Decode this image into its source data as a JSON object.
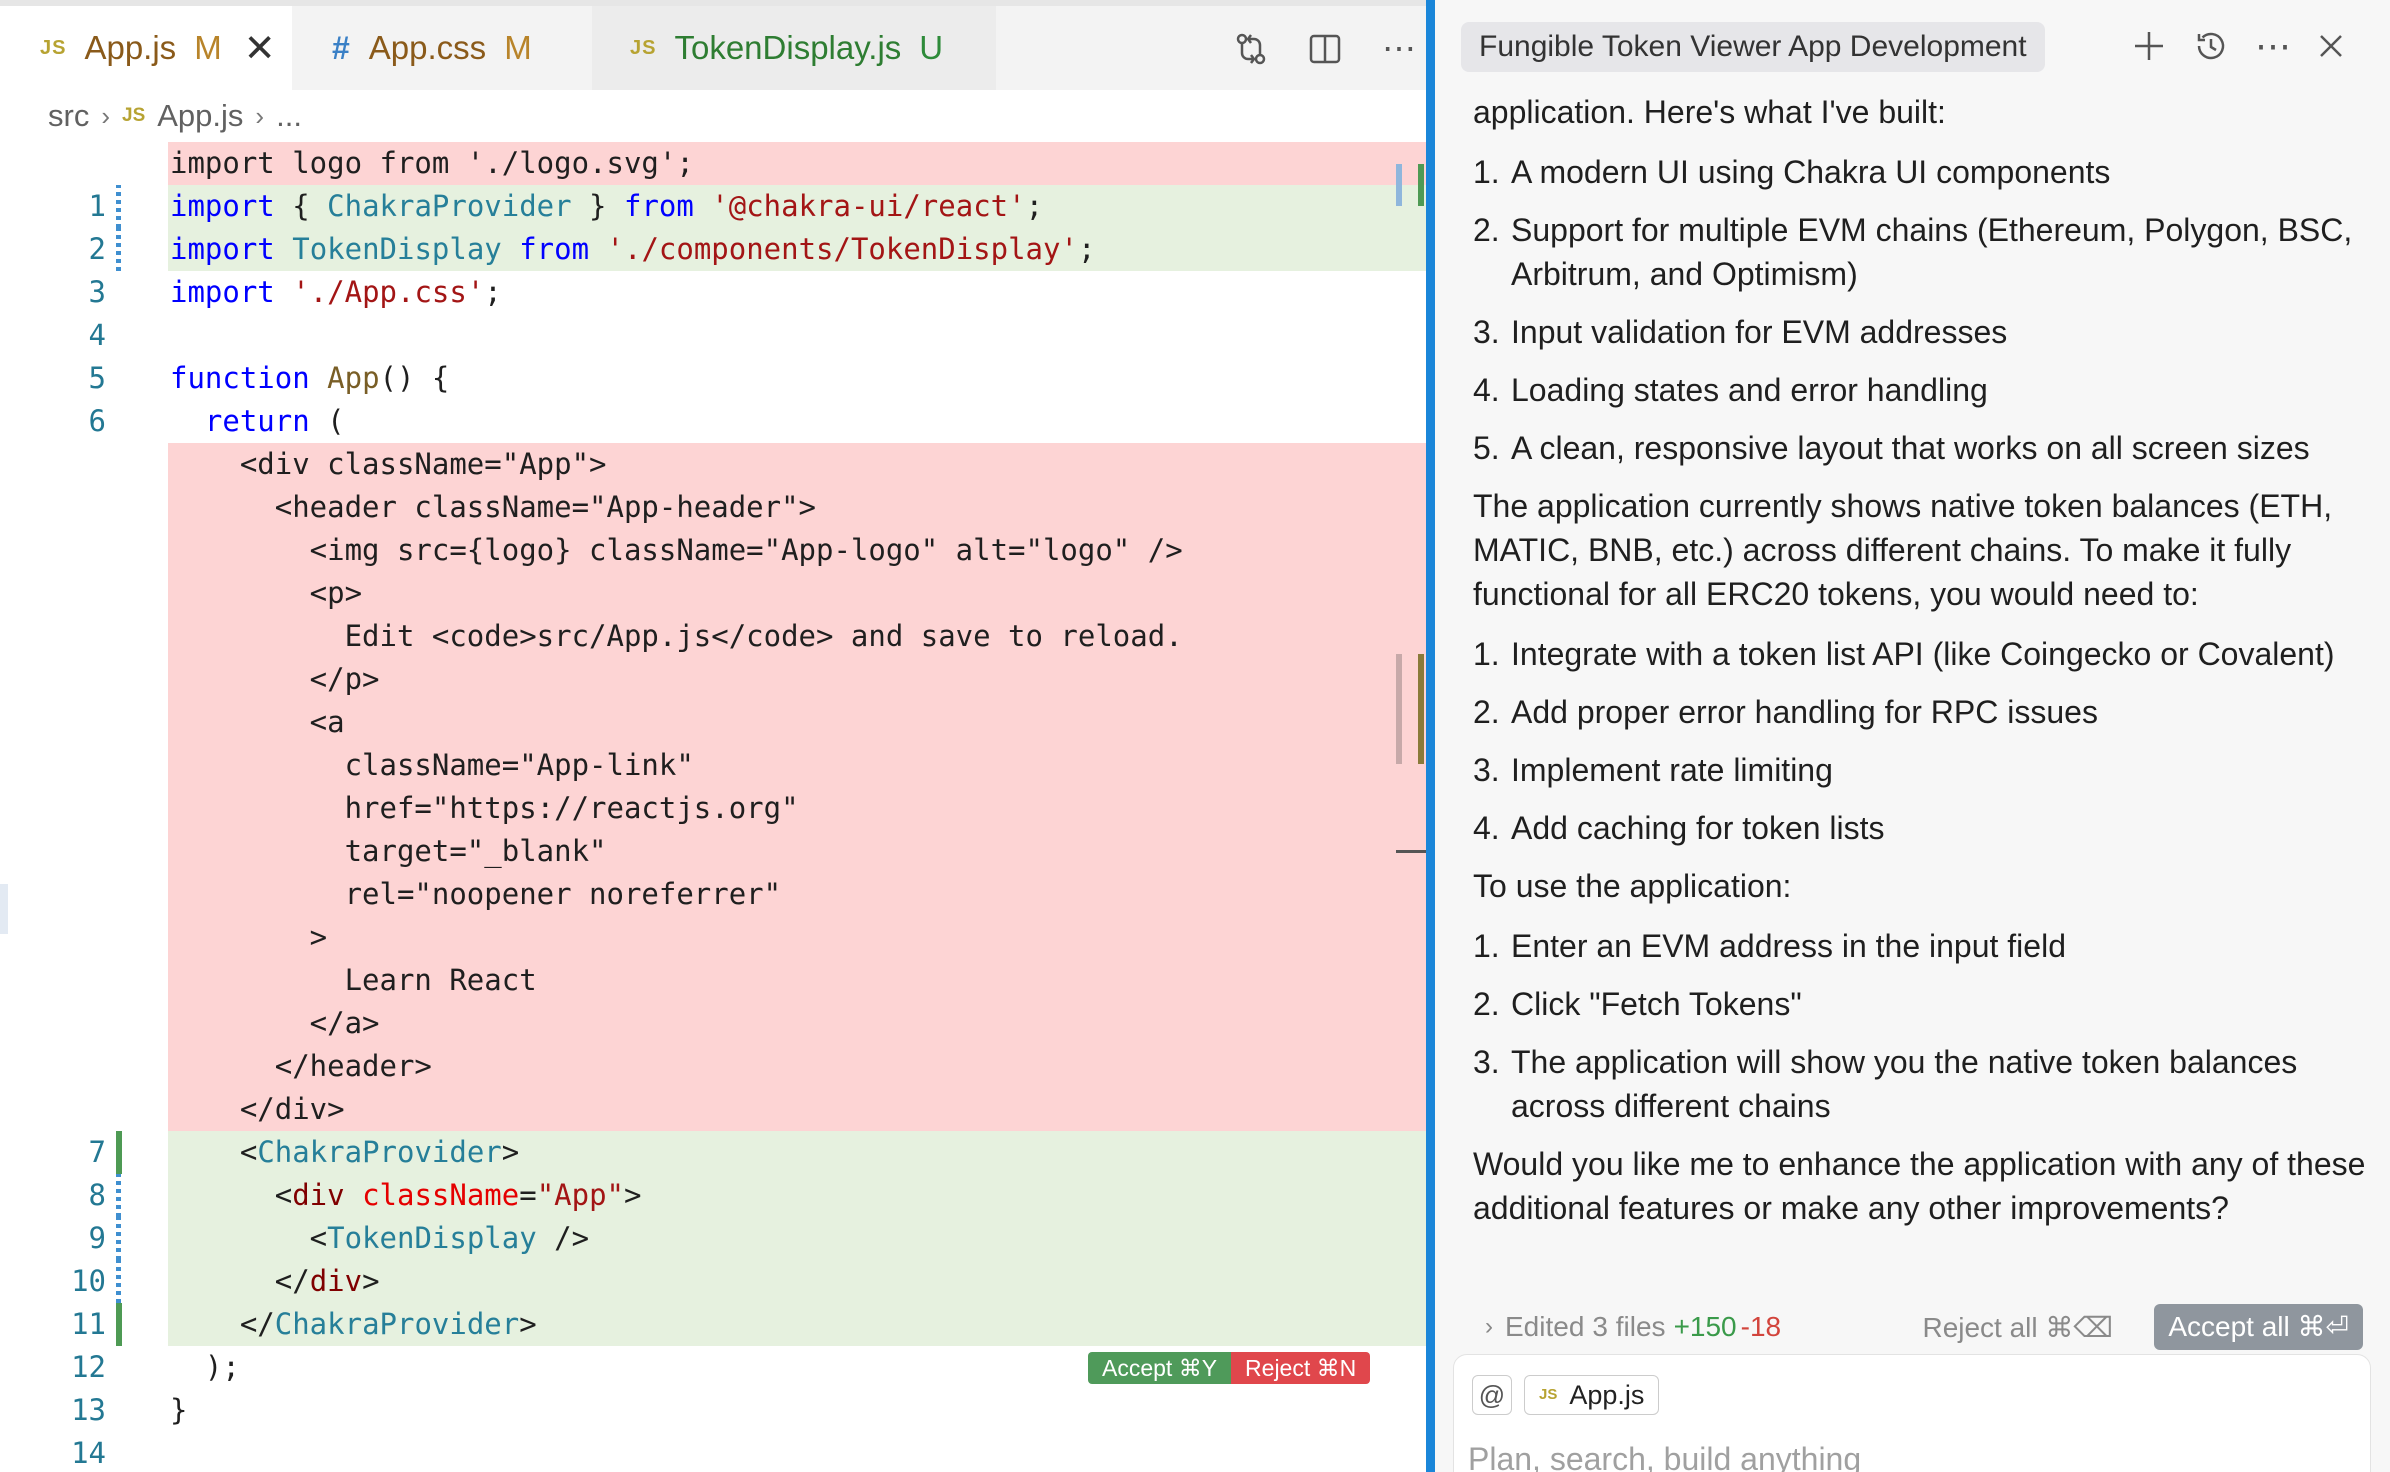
{
  "tabs": [
    {
      "icon": "JS",
      "name": "App.js",
      "status": "M",
      "active": true
    },
    {
      "icon": "#",
      "name": "App.css",
      "status": "M",
      "active": false
    },
    {
      "icon": "JS",
      "name": "TokenDisplay.js",
      "status": "U",
      "active": false
    }
  ],
  "breadcrumb": {
    "folder": "src",
    "file_icon": "JS",
    "file": "App.js",
    "more": "..."
  },
  "code_lines": [
    {
      "n": "",
      "type": "del",
      "text": "import logo from './logo.svg';"
    },
    {
      "n": "1",
      "type": "add",
      "text": "import { ChakraProvider } from '@chakra-ui/react';"
    },
    {
      "n": "2",
      "type": "add",
      "text": "import TokenDisplay from './components/TokenDisplay';"
    },
    {
      "n": "3",
      "type": "ctx",
      "text": "import './App.css';"
    },
    {
      "n": "4",
      "type": "ctx",
      "text": ""
    },
    {
      "n": "5",
      "type": "ctx",
      "text": "function App() {"
    },
    {
      "n": "6",
      "type": "ctx",
      "text": "  return ("
    },
    {
      "n": "",
      "type": "del",
      "text": "    <div className=\"App\">"
    },
    {
      "n": "",
      "type": "del",
      "text": "      <header className=\"App-header\">"
    },
    {
      "n": "",
      "type": "del",
      "text": "        <img src={logo} className=\"App-logo\" alt=\"logo\" />"
    },
    {
      "n": "",
      "type": "del",
      "text": "        <p>"
    },
    {
      "n": "",
      "type": "del",
      "text": "          Edit <code>src/App.js</code> and save to reload."
    },
    {
      "n": "",
      "type": "del",
      "text": "        </p>"
    },
    {
      "n": "",
      "type": "del",
      "text": "        <a"
    },
    {
      "n": "",
      "type": "del",
      "text": "          className=\"App-link\""
    },
    {
      "n": "",
      "type": "del",
      "text": "          href=\"https://reactjs.org\""
    },
    {
      "n": "",
      "type": "del",
      "text": "          target=\"_blank\""
    },
    {
      "n": "",
      "type": "del",
      "text": "          rel=\"noopener noreferrer\""
    },
    {
      "n": "",
      "type": "del",
      "text": "        >"
    },
    {
      "n": "",
      "type": "del",
      "text": "          Learn React"
    },
    {
      "n": "",
      "type": "del",
      "text": "        </a>"
    },
    {
      "n": "",
      "type": "del",
      "text": "      </header>"
    },
    {
      "n": "",
      "type": "del",
      "text": "    </div>"
    },
    {
      "n": "7",
      "type": "add",
      "text": "    <ChakraProvider>"
    },
    {
      "n": "8",
      "type": "add",
      "text": "      <div className=\"App\">"
    },
    {
      "n": "9",
      "type": "add",
      "text": "        <TokenDisplay />"
    },
    {
      "n": "10",
      "type": "add",
      "text": "      </div>"
    },
    {
      "n": "11",
      "type": "add",
      "text": "    </ChakraProvider>"
    },
    {
      "n": "12",
      "type": "ctx",
      "text": "  );"
    },
    {
      "n": "13",
      "type": "ctx",
      "text": "}"
    },
    {
      "n": "14",
      "type": "ctx",
      "text": ""
    }
  ],
  "diff_actions": {
    "accept": "Accept ⌘Y",
    "reject": "Reject ⌘N"
  },
  "chat": {
    "title": "Fungible Token Viewer App Development",
    "intro": "application. Here's what I've built:",
    "built_list": [
      "A modern UI using Chakra UI components",
      "Support for multiple EVM chains (Ethereum, Polygon, BSC, Arbitrum, and Optimism)",
      "Input validation for EVM addresses",
      "Loading states and error handling",
      "A clean, responsive layout that works on all screen sizes"
    ],
    "status_para": "The application currently shows native token balances (ETH, MATIC, BNB, etc.) across different chains. To make it fully functional for all ERC20 tokens, you would need to:",
    "needs_list": [
      "Integrate with a token list API (like Coingecko or Covalent)",
      "Add proper error handling for RPC issues",
      "Implement rate limiting",
      "Add caching for token lists"
    ],
    "usage_intro": "To use the application:",
    "usage_list": [
      "Enter an EVM address in the input field",
      "Click \"Fetch Tokens\"",
      "The application will show you the native token balances across different chains"
    ],
    "closing": "Would you like me to enhance the application with any of these additional features or make any other improvements?",
    "edit_bar": {
      "label": "Edited",
      "files": "3 files",
      "plus": "+150",
      "minus": "-18",
      "reject_all": "Reject all ⌘⌫",
      "accept_all": "Accept all ⌘⏎"
    },
    "composer": {
      "at": "@",
      "chip_icon": "JS",
      "chip_file": "App.js",
      "placeholder": "Plan, search, build anything"
    }
  },
  "colors": {
    "deleted_bg": "#fdd4d4",
    "added_bg": "#e6f1df",
    "accent": "#1a86d9",
    "accept": "#4f9a5a",
    "reject": "#e0474c"
  }
}
